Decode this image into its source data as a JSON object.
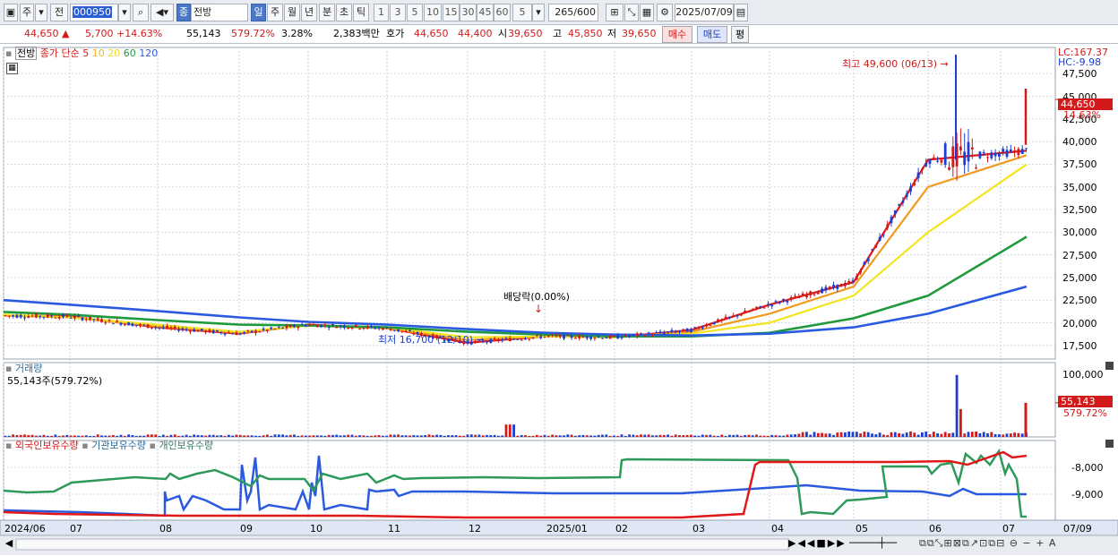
{
  "toolbar": {
    "type": "주",
    "mode": "전",
    "code": "000950",
    "name_tag": "종",
    "name": "전방",
    "periods": [
      "일",
      "주",
      "월",
      "년",
      "분",
      "초",
      "틱"
    ],
    "intervals": [
      "1",
      "3",
      "5",
      "10",
      "15",
      "30",
      "45",
      "60"
    ],
    "custom_interval": "5",
    "bar_count": "265",
    "bar_total": "/600",
    "date": "2025/07/09"
  },
  "info": {
    "price": "44,650",
    "change": "5,700",
    "change_pct": "+14.63%",
    "volume": "55,143",
    "volume_ratio": "579.72%",
    "turnover": "3.28%",
    "amount": "2,383백만",
    "quote_label": "호가",
    "ask": "44,650",
    "bid": "44,400",
    "open_label": "시",
    "open": "39,650",
    "high_label": "고",
    "high": "45,850",
    "low_label": "저",
    "low": "39,650",
    "buy": "매수",
    "sell": "매도",
    "avg": "평"
  },
  "colors": {
    "up": "#d21a1a",
    "down": "#1a3fd2",
    "ma5": "#e01818",
    "ma10": "#f29a1e",
    "ma20": "#f2e41e",
    "ma60": "#1e9a3c",
    "ma120": "#2a5ae0",
    "foreign": "#2a5ae0",
    "institution": "#2e9a5a",
    "individual": "#e01818"
  },
  "price_panel": {
    "legend_name": "전방",
    "legend_ma": "종가 단순",
    "ma_periods": [
      "5",
      "10",
      "20",
      "60",
      "120"
    ],
    "lc": "LC:167.37",
    "hc": "HC:-9.98",
    "high_note": "최고 49,600 (06/13)",
    "low_note": "최저 16,700 (12/10)",
    "dividend_note": "배당락(0.00%)",
    "current_price": "44,650",
    "current_pct": "14.63%",
    "y_ticks": [
      "47,500",
      "45,000",
      "42,500",
      "40,000",
      "37,500",
      "35,000",
      "32,500",
      "30,000",
      "27,500",
      "25,000",
      "22,500",
      "20,000",
      "17,500"
    ]
  },
  "volume_panel": {
    "title": "거래량",
    "value": "55,143주(579.72%)",
    "tick": "100,000",
    "current": "55,143",
    "current_pct": "579.72%"
  },
  "holding_panel": {
    "series": [
      "외국인보유수량",
      "기관보유수량",
      "개인보유수량"
    ],
    "ticks": [
      "-8,000",
      "-9,000"
    ]
  },
  "x_axis": [
    "2024/06",
    "07",
    "08",
    "09",
    "10",
    "11",
    "12",
    "2025/01",
    "02",
    "03",
    "04",
    "05",
    "06",
    "07",
    "07/09"
  ],
  "chart_data": {
    "type": "line",
    "title": "전방",
    "x": [
      "2024/06",
      "07",
      "08",
      "09",
      "10",
      "11",
      "12",
      "2025/01",
      "02",
      "03",
      "04",
      "05",
      "06",
      "07"
    ],
    "ylim": [
      16000,
      50000
    ],
    "series": [
      {
        "name": "5",
        "values": [
          20800,
          20700,
          19500,
          18800,
          19800,
          19400,
          17800,
          18500,
          18400,
          19200,
          22000,
          24500,
          38000,
          39000
        ]
      },
      {
        "name": "10",
        "values": [
          20800,
          20600,
          19600,
          18900,
          19700,
          19400,
          18100,
          18500,
          18400,
          19000,
          21000,
          24000,
          35000,
          38500
        ]
      },
      {
        "name": "20",
        "values": [
          20900,
          20600,
          19800,
          19000,
          19700,
          19500,
          18400,
          18500,
          18400,
          18800,
          20000,
          23000,
          30000,
          37500
        ]
      },
      {
        "name": "60",
        "values": [
          21200,
          20900,
          20300,
          19800,
          19700,
          19500,
          19000,
          18700,
          18500,
          18500,
          18900,
          20500,
          23000,
          29500
        ]
      },
      {
        "name": "120",
        "values": [
          22500,
          22000,
          21300,
          20600,
          20100,
          19800,
          19300,
          18900,
          18700,
          18600,
          18800,
          19500,
          21000,
          24000
        ]
      }
    ]
  }
}
